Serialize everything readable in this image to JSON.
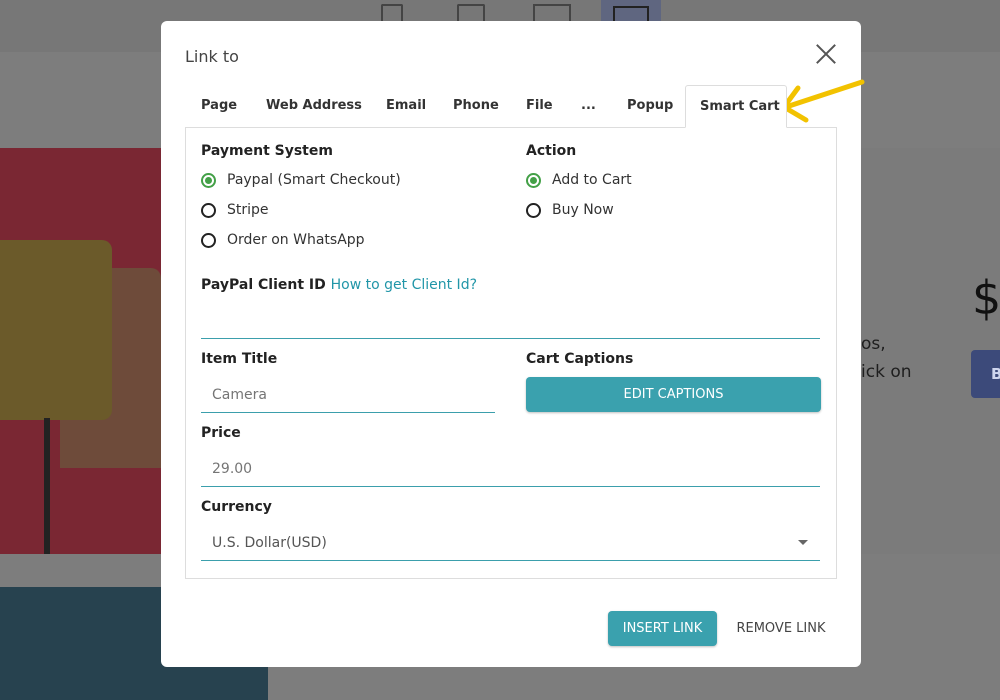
{
  "background": {
    "dollar": "$",
    "text_line1": "os,",
    "text_line2": "ick on",
    "button_letter": "B"
  },
  "modal": {
    "title": "Link to",
    "tabs": [
      {
        "label": "Page"
      },
      {
        "label": "Web Address"
      },
      {
        "label": "Email"
      },
      {
        "label": "Phone"
      },
      {
        "label": "File"
      },
      {
        "label": "..."
      },
      {
        "label": "Popup"
      },
      {
        "label": "Smart Cart",
        "active": true
      }
    ],
    "payment": {
      "label": "Payment System",
      "options": [
        "Paypal (Smart Checkout)",
        "Stripe",
        "Order on WhatsApp"
      ],
      "selected": "Paypal (Smart Checkout)"
    },
    "action": {
      "label": "Action",
      "options": [
        "Add to Cart",
        "Buy Now"
      ],
      "selected": "Add to Cart"
    },
    "client_id": {
      "label": "PayPal Client ID",
      "help_link": "How to get Client Id?",
      "value": ""
    },
    "item_title": {
      "label": "Item Title",
      "placeholder": "Camera",
      "value": ""
    },
    "captions": {
      "label": "Cart Captions",
      "button": "EDIT CAPTIONS"
    },
    "price": {
      "label": "Price",
      "placeholder": "29.00",
      "value": ""
    },
    "currency": {
      "label": "Currency",
      "value": "U.S. Dollar(USD)"
    },
    "footer": {
      "insert": "INSERT LINK",
      "remove": "REMOVE LINK"
    }
  },
  "colors": {
    "accent": "#3aa1ae",
    "radio_checked": "#43a047",
    "annotation_arrow": "#f2c200"
  }
}
